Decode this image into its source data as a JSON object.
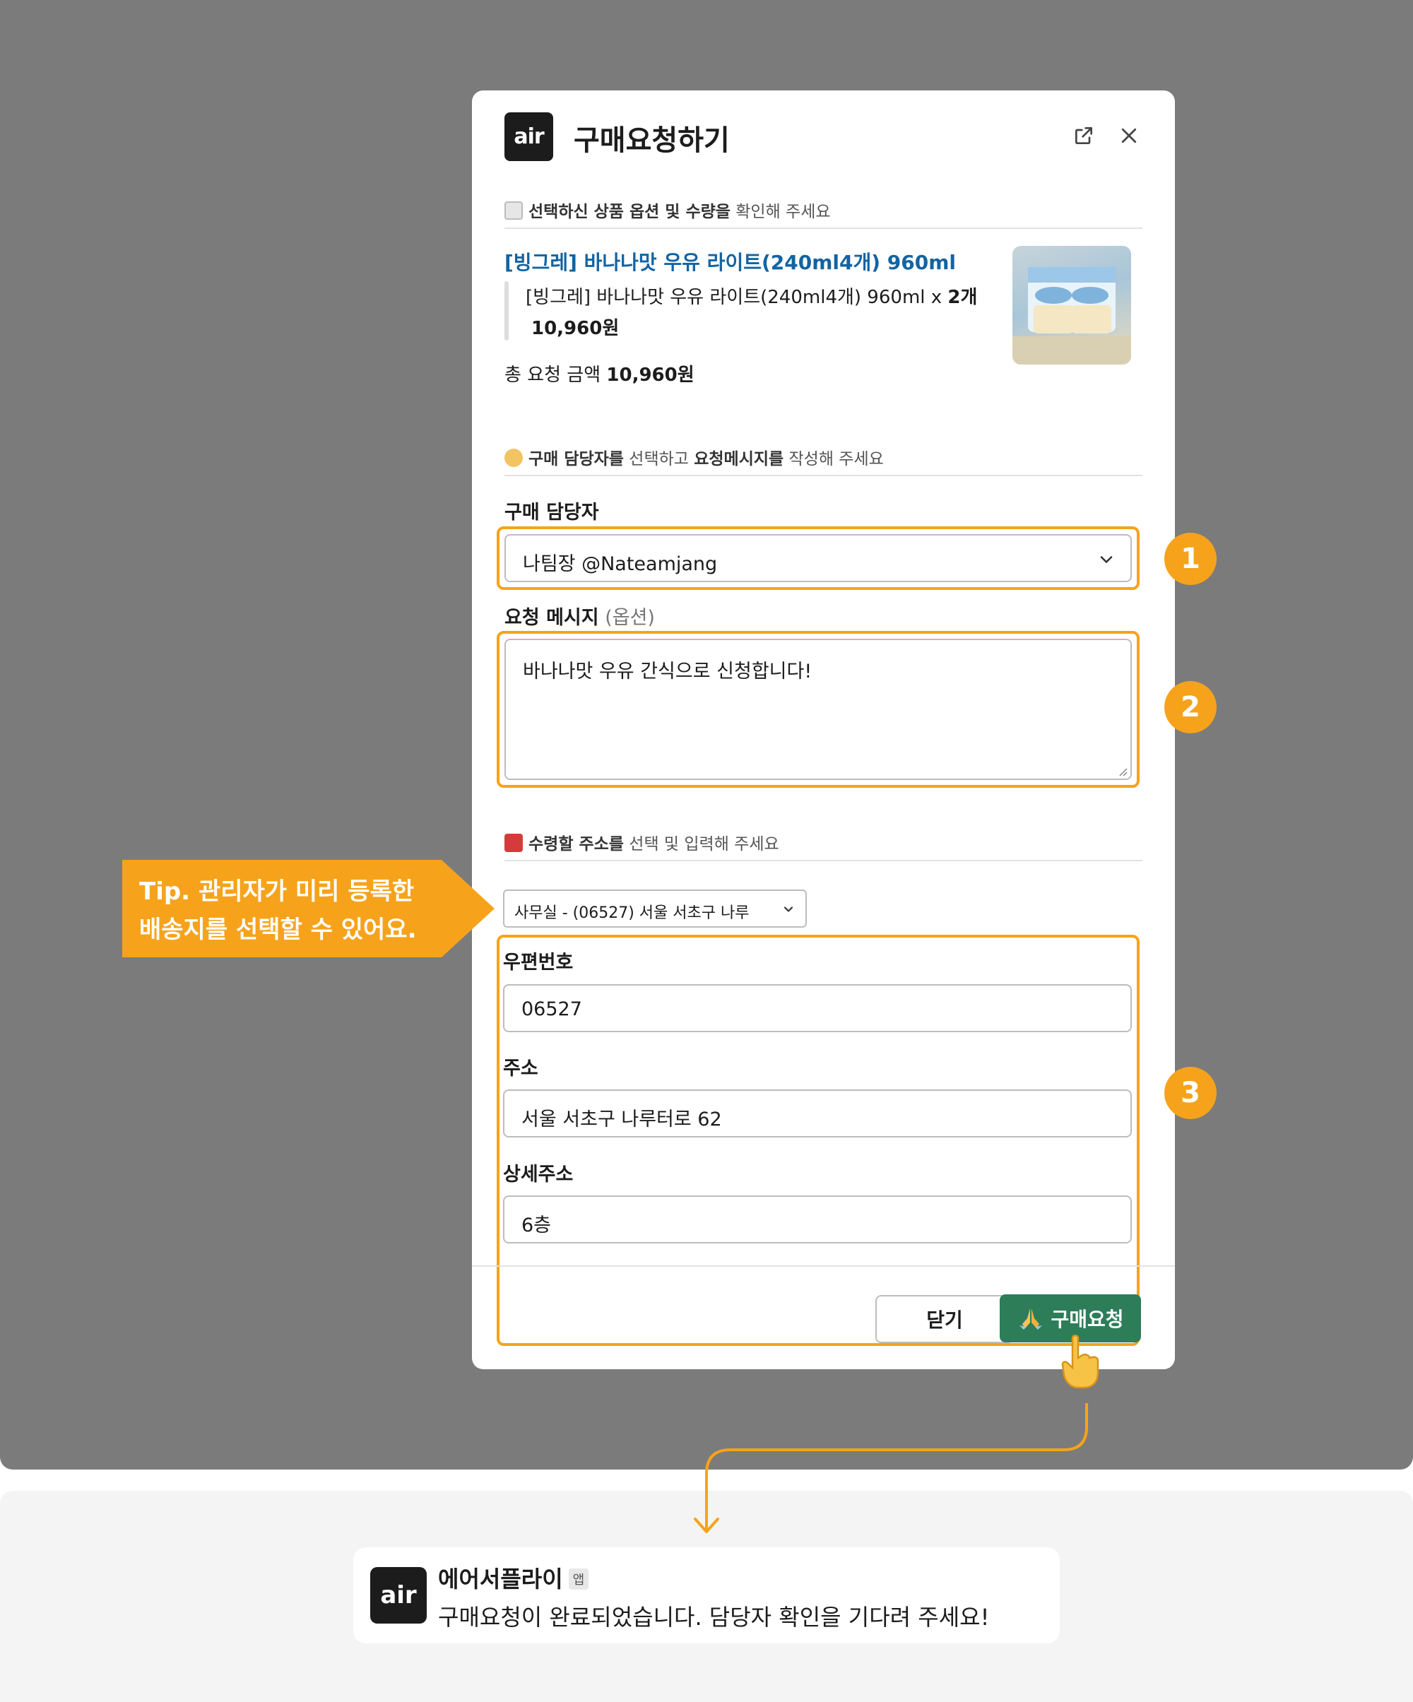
{
  "colors": {
    "accent": "#f6a31b",
    "link": "#1264a3",
    "submit": "#2e7d59",
    "overlay": "#7b7b7b"
  },
  "modal": {
    "logo": "air",
    "title": "구매요청하기",
    "icons": [
      "external-link-icon",
      "close-icon"
    ]
  },
  "product_section": {
    "title_bold1": "선택하신 상품 옵션 및 수량을",
    "title_rest": " 확인해 주세요",
    "product_name": "[빙그레] 바나나맛 우유 라이트(240ml4개) 960ml",
    "option_line": "[빙그레] 바나나맛 우유 라이트(240ml4개) 960ml x ",
    "option_qty": "2개",
    "option_price": "10,960원",
    "total_label": "총 요청 금액 ",
    "total_value": "10,960원"
  },
  "request_section": {
    "title_bold1": "구매 담당자를",
    "title_mid": " 선택하고 ",
    "title_bold2": "요청메시지를",
    "title_rest": " 작성해 주세요",
    "manager_label": "구매 담당자",
    "manager_value": "나팀장 @Nateamjang",
    "message_label": "요청 메시지",
    "message_optional": " (옵션)",
    "message_value": "바나나맛 우유 간식으로 신청합니다!"
  },
  "address_section": {
    "title_bold1": "수령할 주소를",
    "title_rest": " 선택 및 입력해 주세요",
    "preset_value": "사무실 - (06527) 서울 서초구 나루",
    "zip_label": "우편번호",
    "zip_value": "06527",
    "addr_label": "주소",
    "addr_value": "서울 서초구 나루터로 62",
    "detail_label": "상세주소",
    "detail_value": "6층"
  },
  "footer": {
    "close_label": "닫기",
    "submit_label": "구매요청"
  },
  "annotations": {
    "badges": [
      "1",
      "2",
      "3"
    ],
    "tip_line1": "Tip. 관리자가 미리 등록한",
    "tip_line2": "배송지를 선택할 수 있어요."
  },
  "notification": {
    "logo": "air",
    "sender": "에어서플라이",
    "tag": "앱",
    "message": "구매요청이 완료되었습니다. 담당자 확인을 기다려 주세요!"
  }
}
